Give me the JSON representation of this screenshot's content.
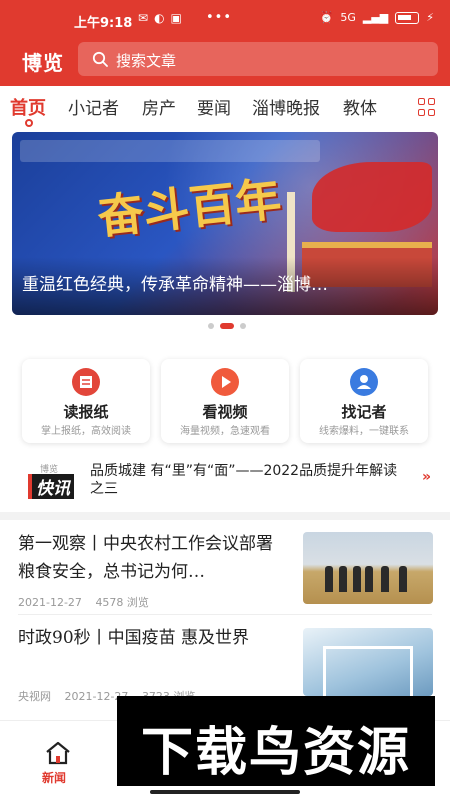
{
  "status_bar": {
    "time": "上午9:18",
    "dots": "•••",
    "network": "5G"
  },
  "header": {
    "logo": "博览",
    "search_placeholder": "搜索文章"
  },
  "tabs": [
    {
      "label": "首页",
      "active": true
    },
    {
      "label": "小记者"
    },
    {
      "label": "房产"
    },
    {
      "label": "要闻"
    },
    {
      "label": "淄博晚报"
    },
    {
      "label": "教体"
    }
  ],
  "banner": {
    "calligraphy": "奋斗百年",
    "caption": "重温红色经典，传承革命精神——淄博…"
  },
  "carousel": {
    "count": 3,
    "active_index": 1
  },
  "quick_links": [
    {
      "title": "读报纸",
      "subtitle": "掌上报纸，高效阅读",
      "icon": "newspaper-icon",
      "color": "#e2463a"
    },
    {
      "title": "看视频",
      "subtitle": "海量视频，急速观看",
      "icon": "play-video-icon",
      "color": "#f05a3c"
    },
    {
      "title": "找记者",
      "subtitle": "线索爆料，一键联系",
      "icon": "reporter-icon",
      "color": "#3a7be0"
    }
  ],
  "flash_news": {
    "logo_top": "博览",
    "logo_main": "快讯",
    "text": "品质城建 有“里”有“面”——2022品质提升年解读之三"
  },
  "articles": [
    {
      "title": "第一观察丨中央农村工作会议部署粮食安全，总书记为何…",
      "date": "2021-12-27",
      "views": "4578 浏览"
    },
    {
      "title": "时政90秒丨中国疫苗 惠及世界",
      "source": "央视网",
      "date": "2021-12-27",
      "views": "3723 浏览"
    }
  ],
  "bottom_nav": {
    "home_label": "新闻"
  },
  "watermark": "下载鸟资源",
  "colors": {
    "brand": "#e03a2f"
  }
}
